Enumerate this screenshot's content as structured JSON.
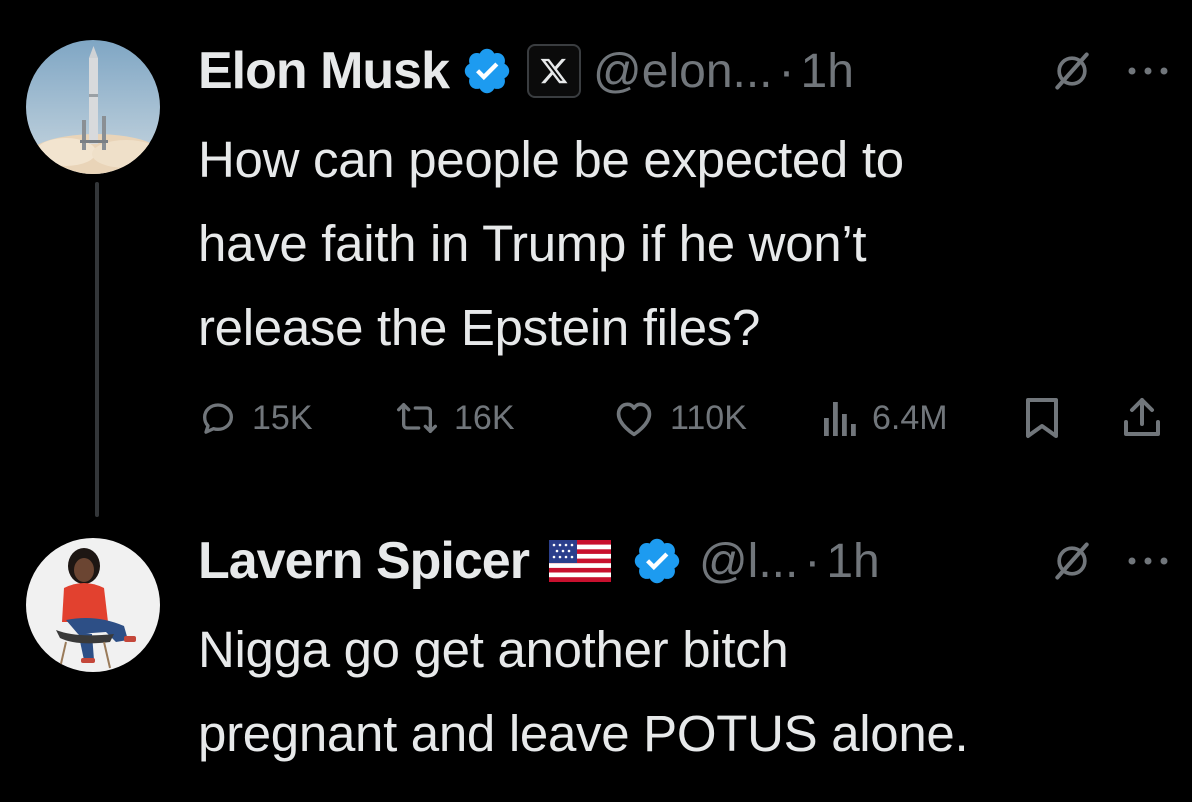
{
  "tweets": [
    {
      "name": "Elon Musk",
      "verified": true,
      "affiliation_badge": "X",
      "handle": "@elon...",
      "separator": "·",
      "time": "1h",
      "text": "How can people be expected to\nhave faith in Trump if he won’t\nrelease the Epstein files?",
      "actions": {
        "replies": "15K",
        "reposts": "16K",
        "likes": "110K",
        "views": "6.4M"
      },
      "icons": [
        "grok-icon",
        "more-icon",
        "reply-icon",
        "repost-icon",
        "like-icon",
        "views-icon",
        "bookmark-icon",
        "share-icon"
      ]
    },
    {
      "name": "Lavern Spicer",
      "flag": "🇺🇸",
      "verified": true,
      "handle": "@l...",
      "separator": "·",
      "time": "1h",
      "text": "Nigga go get another bitch\npregnant and leave POTUS alone.",
      "icons": [
        "grok-icon",
        "more-icon"
      ]
    }
  ],
  "colors": {
    "background": "#000000",
    "text": "#e7e9ea",
    "secondary": "#71767b",
    "verified": "#1d9bf0",
    "thread_line": "#333639"
  }
}
